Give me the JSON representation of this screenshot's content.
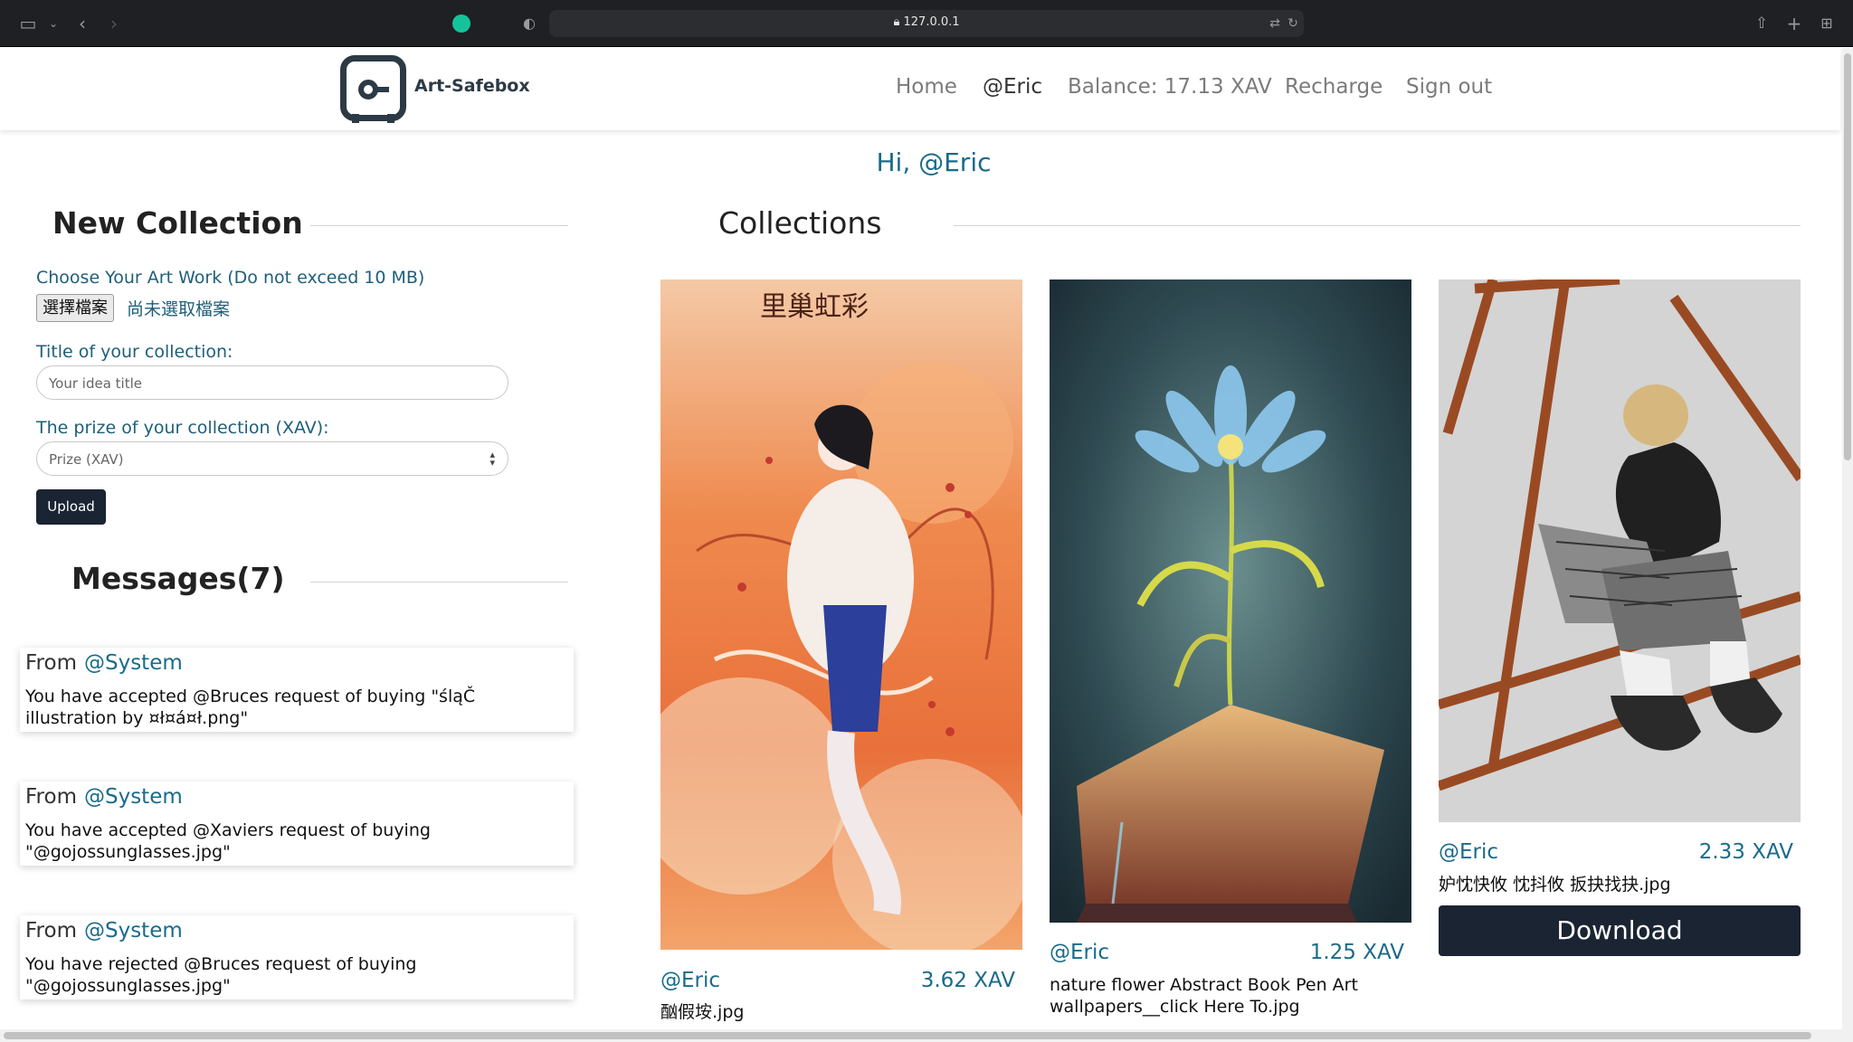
{
  "browser": {
    "url": "127.0.0.1"
  },
  "navbar": {
    "brand": "Art-Safebox",
    "home": "Home",
    "user": "@Eric",
    "balance": "Balance: 17.13 XAV",
    "recharge": "Recharge",
    "signout": "Sign out"
  },
  "greeting": "Hi, @Eric",
  "new_collection": {
    "title": "New Collection",
    "file_label": "Choose Your Art Work (Do not exceed 10 MB)",
    "file_button": "選擇檔案",
    "file_status": "尚未選取檔案",
    "title_label": "Title of your collection:",
    "title_placeholder": "Your idea title",
    "prize_label": "The prize of your collection (XAV):",
    "prize_placeholder": "Prize (XAV)",
    "upload": "Upload"
  },
  "messages": {
    "title": "Messages(7)",
    "from_label": "From",
    "items": [
      {
        "sender": "@System",
        "text": "You have accepted @Bruces request of buying \"śląČ illustration by ¤ł¤á¤ł.png\""
      },
      {
        "sender": "@System",
        "text": "You have accepted @Xaviers request of buying \"@gojossunglasses.jpg\""
      },
      {
        "sender": "@System",
        "text": "You have rejected @Bruces request of buying \"@gojossunglasses.jpg\""
      }
    ]
  },
  "collections": {
    "title": "Collections",
    "items": [
      {
        "owner": "@Eric",
        "price": "3.62 XAV",
        "filename": "酗假垵.jpg"
      },
      {
        "owner": "@Eric",
        "price": "1.25 XAV",
        "filename": "nature flower Abstract Book Pen Art wallpapers__click Here To.jpg"
      },
      {
        "owner": "@Eric",
        "price": "2.33 XAV",
        "filename": "妒忱快攸 忱抖攸 扳抉找抉.jpg",
        "download": "Download"
      }
    ]
  },
  "colors": {
    "accent": "#1a6b8a",
    "dark_button": "#1b2433"
  }
}
